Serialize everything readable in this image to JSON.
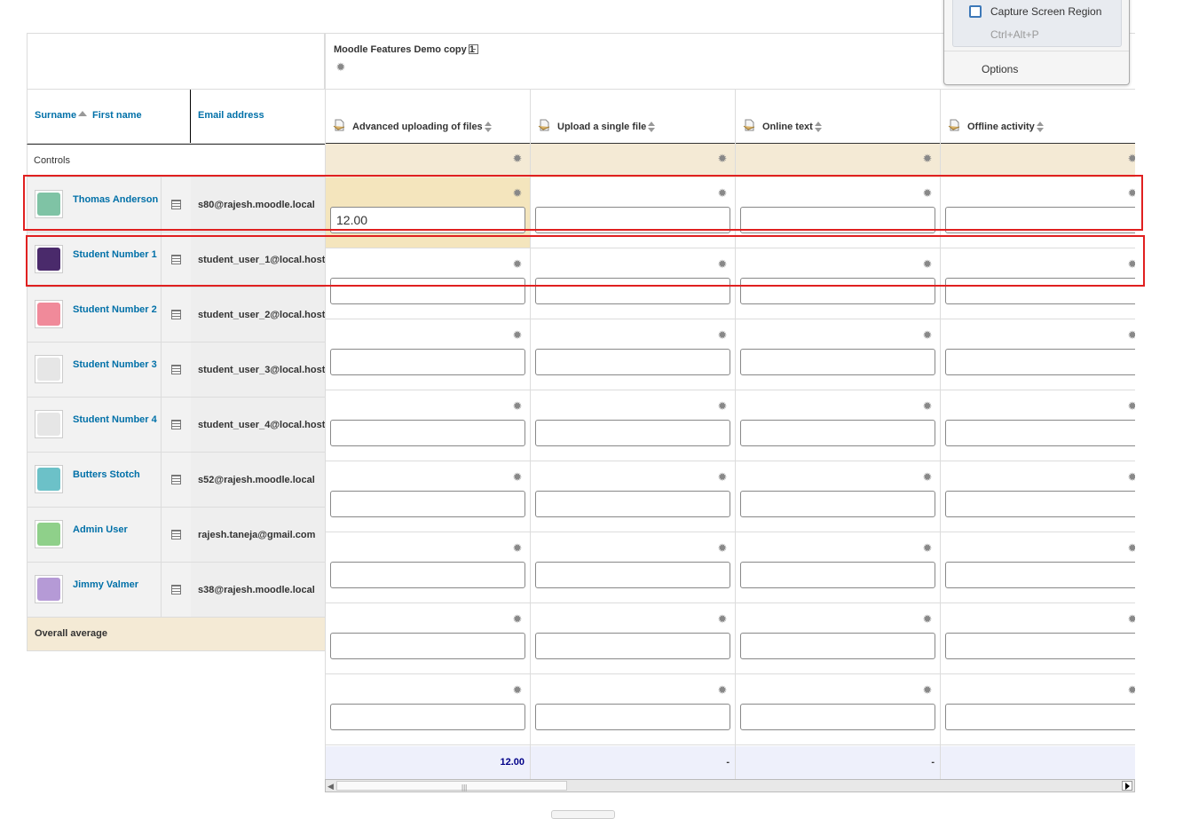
{
  "category": {
    "title": "Moodle Features Demo copy 1"
  },
  "header": {
    "surname": "Surname",
    "first_name": "First name",
    "email": "Email address",
    "controls": "Controls",
    "overall_average": "Overall average"
  },
  "columns": [
    {
      "label": "Advanced uploading of files",
      "average": "12.00"
    },
    {
      "label": "Upload a single file",
      "average": "-"
    },
    {
      "label": "Online text",
      "average": "-"
    },
    {
      "label": "Offline activity",
      "average": ""
    }
  ],
  "users": [
    {
      "name": "Thomas Anderson",
      "email": "s80@rajesh.moodle.local",
      "avatar_color": "#7fc3a5",
      "grades": [
        "12.00",
        "",
        "",
        ""
      ]
    },
    {
      "name": "Student Number 1",
      "email": "student_user_1@local.host",
      "avatar_color": "#4a2a6b",
      "grades": [
        "",
        "",
        "",
        ""
      ]
    },
    {
      "name": "Student Number 2",
      "email": "student_user_2@local.host",
      "avatar_color": "#f08a9a",
      "grades": [
        "",
        "",
        "",
        ""
      ]
    },
    {
      "name": "Student Number 3",
      "email": "student_user_3@local.host",
      "avatar_color": "#e6e6e6",
      "grades": [
        "",
        "",
        "",
        ""
      ]
    },
    {
      "name": "Student Number 4",
      "email": "student_user_4@local.host",
      "avatar_color": "#e6e6e6",
      "grades": [
        "",
        "",
        "",
        ""
      ]
    },
    {
      "name": "Butters Stotch",
      "email": "s52@rajesh.moodle.local",
      "avatar_color": "#6cc1c8",
      "grades": [
        "",
        "",
        "",
        ""
      ]
    },
    {
      "name": "Admin User",
      "email": "rajesh.taneja@gmail.com",
      "avatar_color": "#8fd08a",
      "grades": [
        "",
        "",
        "",
        ""
      ]
    },
    {
      "name": "Jimmy Valmer",
      "email": "s38@rajesh.moodle.local",
      "avatar_color": "#b59ad6",
      "grades": [
        "",
        "",
        "",
        ""
      ]
    }
  ],
  "context_menu": {
    "capture_label": "Capture Screen Region",
    "capture_shortcut": "Ctrl+Alt+P",
    "options_label": "Options"
  },
  "colors": {
    "link": "#0070a8",
    "highlight": "#e02020",
    "controls_bg": "#f4ead5",
    "average_bg": "#eef0fb"
  }
}
